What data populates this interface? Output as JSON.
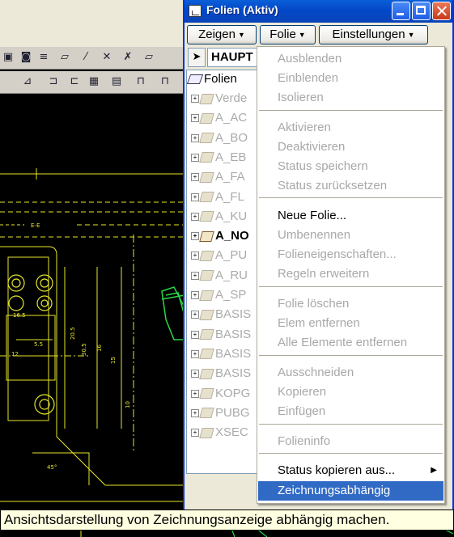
{
  "window": {
    "title": "Folien (Aktiv)",
    "menu_buttons": [
      {
        "label": "Zeigen"
      },
      {
        "label": "Folie"
      },
      {
        "label": "Einstellungen"
      }
    ],
    "current_layer": "HAUPT"
  },
  "tree": {
    "root_label": "Folien",
    "items": [
      {
        "label": "Verde",
        "active": false
      },
      {
        "label": "A_AC",
        "active": false
      },
      {
        "label": "A_BO",
        "active": false
      },
      {
        "label": "A_EB",
        "active": false
      },
      {
        "label": "A_FA",
        "active": false
      },
      {
        "label": "A_FL",
        "active": false
      },
      {
        "label": "A_KU",
        "active": false
      },
      {
        "label": "A_NO",
        "active": true
      },
      {
        "label": "A_PU",
        "active": false
      },
      {
        "label": "A_RU",
        "active": false
      },
      {
        "label": "A_SP",
        "active": false
      },
      {
        "label": "BASIS",
        "active": false
      },
      {
        "label": "BASIS",
        "active": false
      },
      {
        "label": "BASIS",
        "active": false
      },
      {
        "label": "BASIS",
        "active": false
      },
      {
        "label": "KOPG",
        "active": false
      },
      {
        "label": "PUBG",
        "active": false
      },
      {
        "label": "XSEC",
        "active": false
      }
    ]
  },
  "menu": {
    "items": [
      {
        "label": "Ausblenden",
        "enabled": false
      },
      {
        "label": "Einblenden",
        "enabled": false
      },
      {
        "label": "Isolieren",
        "enabled": false
      },
      {
        "label": "Aktivieren",
        "enabled": false
      },
      {
        "label": "Deaktivieren",
        "enabled": false
      },
      {
        "label": "Status speichern",
        "enabled": false
      },
      {
        "label": "Status zurücksetzen",
        "enabled": false
      },
      {
        "label": "Neue Folie...",
        "enabled": true
      },
      {
        "label": "Umbenennen",
        "enabled": false
      },
      {
        "label": "Folieneigenschaften...",
        "enabled": false
      },
      {
        "label": "Regeln erweitern",
        "enabled": false
      },
      {
        "label": "Folie löschen",
        "enabled": false
      },
      {
        "label": "Elem entfernen",
        "enabled": false
      },
      {
        "label": "Alle Elemente entfernen",
        "enabled": false
      },
      {
        "label": "Ausschneiden",
        "enabled": false
      },
      {
        "label": "Kopieren",
        "enabled": false
      },
      {
        "label": "Einfügen",
        "enabled": false
      },
      {
        "label": "Folieninfo",
        "enabled": false
      },
      {
        "label": "Status kopieren aus...",
        "enabled": true,
        "submenu": true
      },
      {
        "label": "Zeichnungsabhängig",
        "enabled": true,
        "highlighted": true
      }
    ]
  },
  "tooltip": {
    "text": "Ansichtsdarstellung von Zeichnungsanzeige abhängig machen."
  },
  "cad": {
    "labels": [
      "E-E",
      "16.5",
      "5.5",
      "12",
      "20.5",
      "30.5",
      "15",
      "16",
      "45°",
      "10"
    ]
  },
  "colors": {
    "titlebar": "#0348c8",
    "menu_highlight": "#316ac5",
    "tooltip_bg": "#ffffe1",
    "cad_yellow": "#e6e62a",
    "cad_green": "#2ad84a"
  }
}
